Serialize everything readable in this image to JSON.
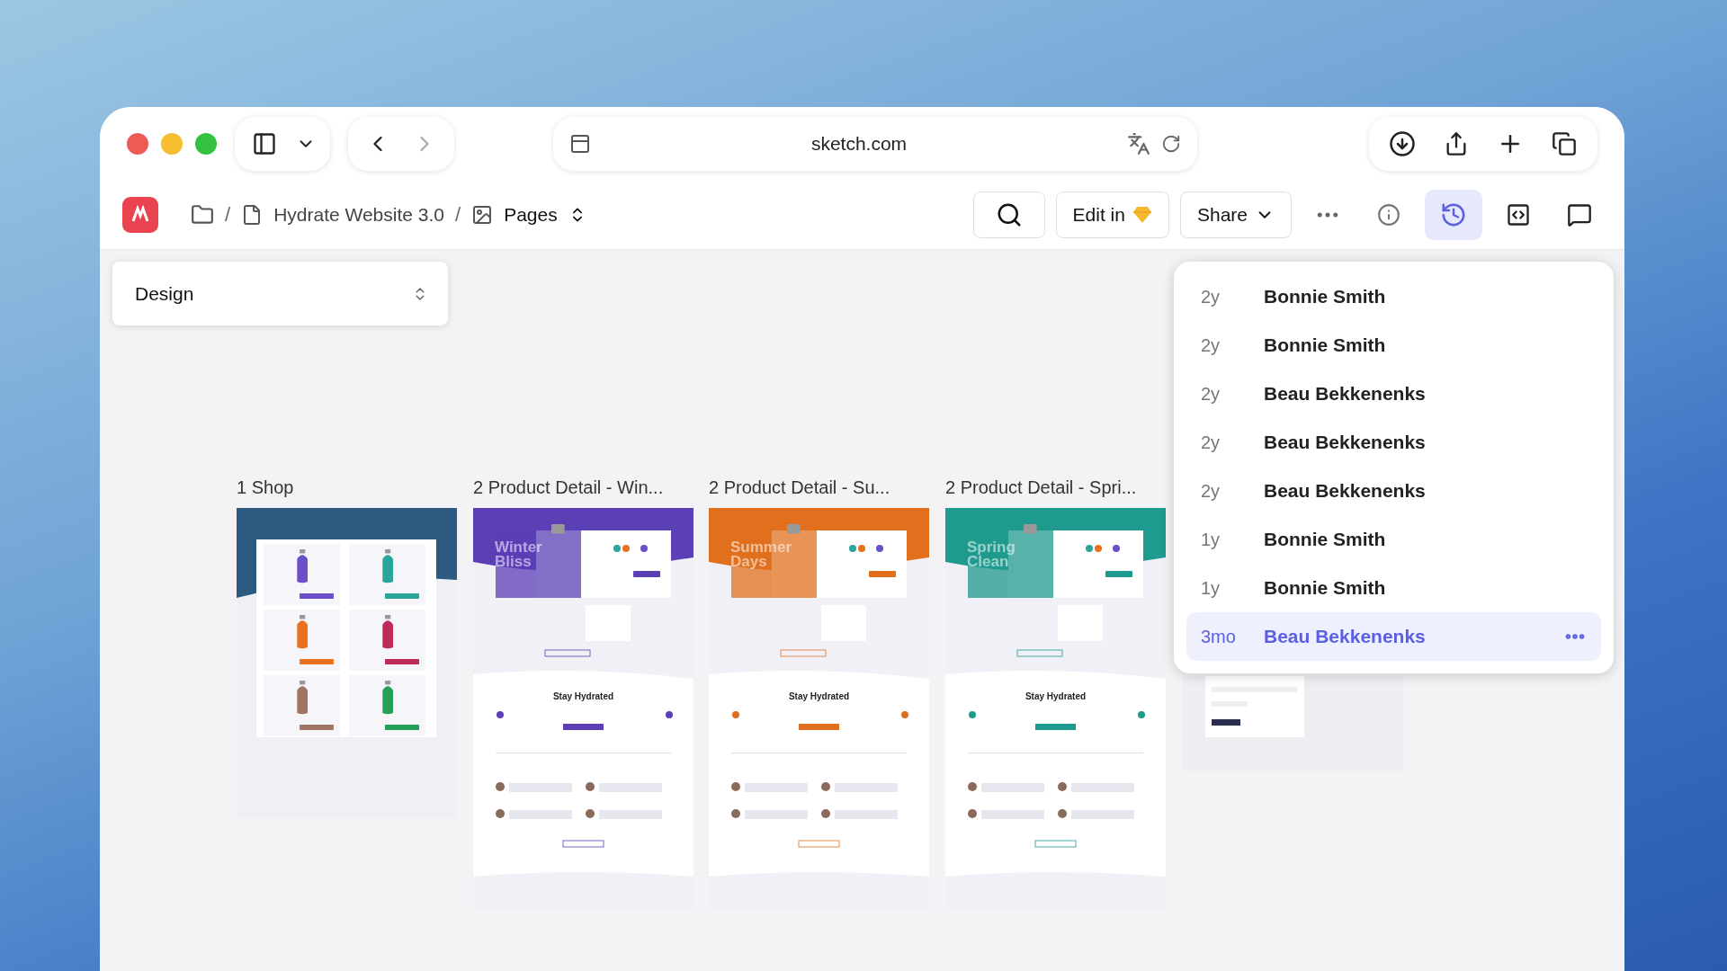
{
  "browser": {
    "address": "sketch.com"
  },
  "toolbar": {
    "separators": [
      "/",
      "/"
    ],
    "project": "Hydrate Website 3.0",
    "pages": "Pages",
    "edit_button": "Edit in",
    "share_button": "Share"
  },
  "page_selector": {
    "value": "Design"
  },
  "artboards": [
    {
      "kind": "shop",
      "label": "1 Shop",
      "color": "#2c5a80"
    },
    {
      "kind": "product",
      "label": "2 Product Detail - Win...",
      "color": "#5b3fb5",
      "hero_title": "Winter Bliss",
      "section_title": "Stay Hydrated"
    },
    {
      "kind": "product",
      "label": "2 Product Detail - Su...",
      "color": "#e0701e",
      "hero_title": "Summer Days",
      "section_title": "Stay Hydrated"
    },
    {
      "kind": "product",
      "label": "2 Product Detail - Spri...",
      "color": "#1f9a8e",
      "hero_title": "Spring Clean",
      "section_title": "Stay Hydrated"
    },
    {
      "kind": "form",
      "color": "#2a2f4f"
    }
  ],
  "history": [
    {
      "age": "2y",
      "author": "Bonnie Smith",
      "selected": false
    },
    {
      "age": "2y",
      "author": "Bonnie Smith",
      "selected": false
    },
    {
      "age": "2y",
      "author": "Beau Bekkenenks",
      "selected": false
    },
    {
      "age": "2y",
      "author": "Beau Bekkenenks",
      "selected": false
    },
    {
      "age": "2y",
      "author": "Beau Bekkenenks",
      "selected": false
    },
    {
      "age": "1y",
      "author": "Bonnie Smith",
      "selected": false
    },
    {
      "age": "1y",
      "author": "Bonnie Smith",
      "selected": false
    },
    {
      "age": "3mo",
      "author": "Beau Bekkenenks",
      "selected": true
    }
  ]
}
